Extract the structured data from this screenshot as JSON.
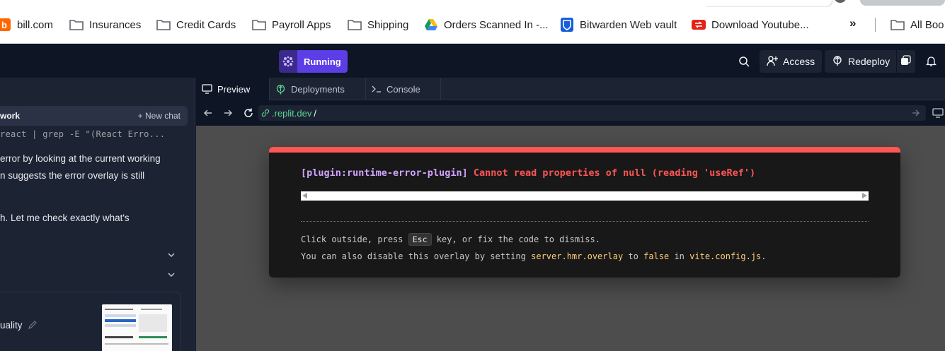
{
  "bookmarks": {
    "items": [
      {
        "label": "bill.com",
        "icon": "billcom-icon"
      },
      {
        "label": "Insurances",
        "icon": "folder-icon"
      },
      {
        "label": "Credit Cards",
        "icon": "folder-icon"
      },
      {
        "label": "Payroll Apps",
        "icon": "folder-icon"
      },
      {
        "label": "Shipping",
        "icon": "folder-icon"
      },
      {
        "label": "Orders Scanned In -...",
        "icon": "google-drive-icon"
      },
      {
        "label": "Bitwarden Web vault",
        "icon": "bitwarden-icon"
      },
      {
        "label": "Download Youtube...",
        "icon": "youtube-downloader-icon"
      }
    ],
    "overflow": "»",
    "all_bookmarks": "All Boo"
  },
  "topbar": {
    "status_label": "Running",
    "access_label": "Access",
    "redeploy_label": "Redeploy"
  },
  "left_panel": {
    "header_title": "work",
    "new_chat_label": "+ New chat",
    "code_line": "react | grep -E \"(React Erro...",
    "text_lines": [
      "error by looking at the current working",
      "n suggests the error overlay is still",
      "h. Let me check exactly what's"
    ],
    "card_text": "uality"
  },
  "tabs": [
    {
      "label": "Preview",
      "icon": "monitor-icon"
    },
    {
      "label": "Deployments",
      "icon": "deployments-icon"
    },
    {
      "label": "Console",
      "icon": "terminal-icon"
    }
  ],
  "url": {
    "host": ".replit.dev",
    "path": "/"
  },
  "error_overlay": {
    "plugin": "[plugin:runtime-error-plugin]",
    "message": "Cannot read properties of null (reading 'useRef')",
    "line1_prefix": "Click outside, press",
    "line1_key": "Esc",
    "line1_suffix": "key, or fix the code to dismiss.",
    "line2_prefix": "You can also disable this overlay by setting",
    "line2_setting": "server.hmr.overlay",
    "line2_mid1": "to",
    "line2_value": "false",
    "line2_mid2": "in",
    "line2_file": "vite.config.js",
    "line2_end": "."
  },
  "colors": {
    "error_red": "#ff5555",
    "running_purple": "#5b3ee6",
    "url_green": "#5cd692",
    "editor_bg": "#0e1525",
    "panel_bg": "#1c2333"
  }
}
